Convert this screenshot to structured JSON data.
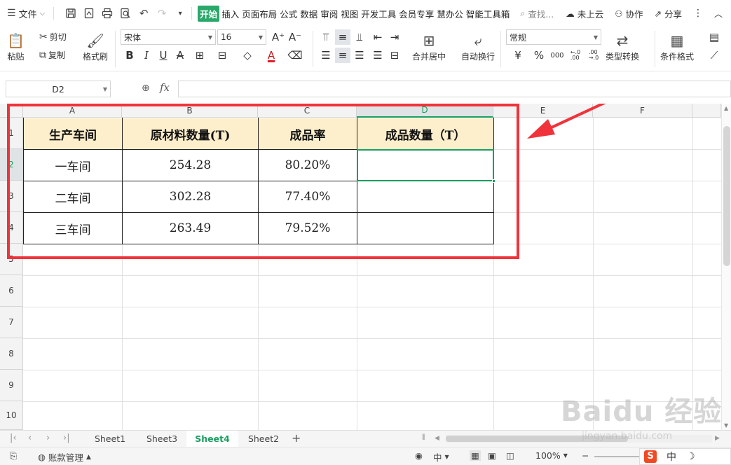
{
  "menubar": {
    "file_label": "文件",
    "tabs": [
      {
        "label": "开始",
        "active": true
      },
      {
        "label": "插入"
      },
      {
        "label": "页面布局"
      },
      {
        "label": "公式"
      },
      {
        "label": "数据"
      },
      {
        "label": "审阅"
      },
      {
        "label": "视图"
      },
      {
        "label": "开发工具"
      },
      {
        "label": "会员专享"
      },
      {
        "label": "慧办公"
      },
      {
        "label": "智能工具箱"
      }
    ],
    "search_label": "查找...",
    "cloud_label": "未上云",
    "collab_label": "协作",
    "share_label": "分享"
  },
  "ribbon": {
    "paste_label": "粘贴",
    "cut_label": "剪切",
    "copy_label": "复制",
    "format_painter_label": "格式刷",
    "font_name": "宋体",
    "font_size": "16",
    "merge_center_label": "合并居中",
    "wrap_text_label": "自动换行",
    "number_format": "常规",
    "type_convert_label": "类型转换",
    "cond_format_label": "条件格式",
    "bold": "B",
    "italic": "I",
    "underline": "U",
    "strike": "A",
    "font_color": "A",
    "currency": "¥",
    "percent": "%",
    "thousands": "000",
    "inc_decimal": "←.0\n.00",
    "dec_decimal": ".00\n→.0",
    "font_grow": "A⁺",
    "font_shrink": "A⁻"
  },
  "formula_bar": {
    "name_box": "D2",
    "fx_label": "fx",
    "formula": ""
  },
  "grid": {
    "columns": [
      "A",
      "B",
      "C",
      "D",
      "E",
      "F"
    ],
    "selected_column": "D",
    "rows": [
      "1",
      "2",
      "3",
      "4",
      "5",
      "6",
      "7",
      "8",
      "9",
      "10"
    ],
    "selected_row": "2",
    "header_row": [
      "生产车间",
      "原材料数量(T)",
      "成品率",
      "成品数量（T）"
    ],
    "data_rows": [
      [
        "一车间",
        "254.28",
        "80.20%",
        ""
      ],
      [
        "二车间",
        "302.28",
        "77.40%",
        ""
      ],
      [
        "三车间",
        "263.49",
        "79.52%",
        ""
      ]
    ],
    "header_fill": "#fdefcc",
    "annotation_color": "#f0333a"
  },
  "sheets": {
    "tabs": [
      {
        "label": "Sheet1"
      },
      {
        "label": "Sheet3"
      },
      {
        "label": "Sheet4",
        "active": true
      },
      {
        "label": "Sheet2"
      }
    ],
    "add_label": "+"
  },
  "statusbar": {
    "account_label": "账款管理",
    "zoom": "100%",
    "ime_label": "中"
  },
  "watermark": {
    "brand": "Baidu 经验",
    "url": "jingyan.baidu.com"
  }
}
